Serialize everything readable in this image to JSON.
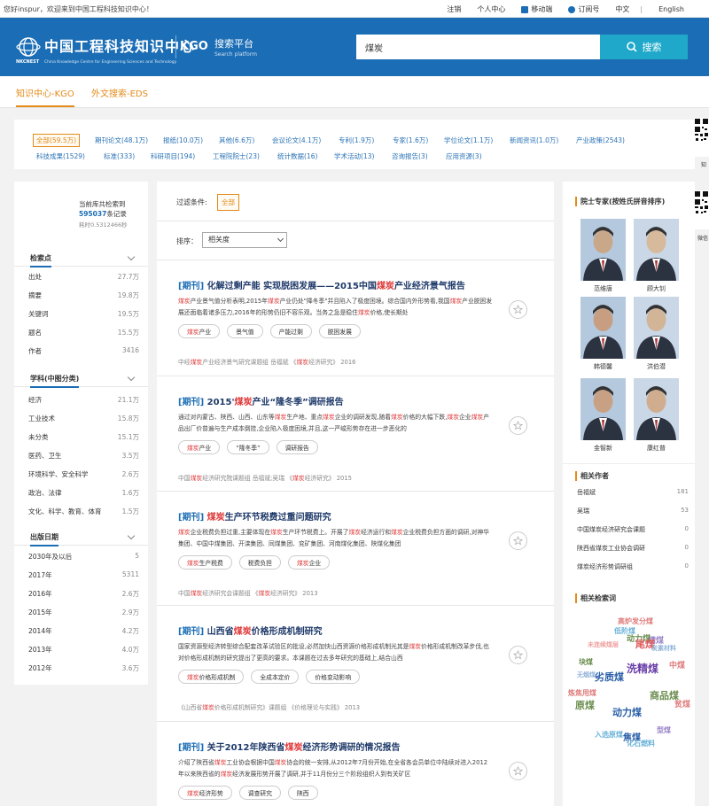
{
  "topbar": {
    "welcome": "您好inspur，欢迎来到中国工程科技知识中心！",
    "links": [
      "注销",
      "个人中心",
      "移动端",
      "订阅号",
      "中文",
      "|",
      "English"
    ]
  },
  "header": {
    "logo_abbr": "NKCNEST",
    "logo_title": "中国工程科技知识中心",
    "logo_subtitle": "China Knowledge Centre for Engineering Sciences and Technology",
    "kgo_mark": "KGO",
    "kgo_title": "搜索平台",
    "kgo_subtitle": "Search platform",
    "search_value": "煤炭",
    "search_button": "搜索"
  },
  "tabs": [
    {
      "label": "知识中心-KGO",
      "active": true
    },
    {
      "label": "外文搜索-EDS",
      "active": false
    }
  ],
  "categories": {
    "row1": [
      "全部(59.5万)",
      "期刊论文(48.1万)",
      "报纸(10.0万)",
      "其他(6.6万)",
      "会议论文(4.1万)",
      "专利(1.9万)",
      "专家(1.6万)",
      "学位论文(1.1万)",
      "新闻资讯(1.0万)",
      "产业政策(2543)"
    ],
    "row2": [
      "科技成果(1529)",
      "标准(333)",
      "科研项目(194)",
      "工程院院士(23)",
      "统计数据(16)",
      "学术活动(13)",
      "咨询报告(3)",
      "应用资源(3)"
    ]
  },
  "qr_labels": [
    "知",
    "微信"
  ],
  "stats": {
    "line1": "当前库共检索到",
    "count": "595037",
    "count_suffix": "条记录",
    "time": "耗时0.5312466秒"
  },
  "filters": {
    "retrieval": {
      "title": "检索点",
      "rows": [
        {
          "k": "出处",
          "v": "27.7万"
        },
        {
          "k": "摘要",
          "v": "19.8万"
        },
        {
          "k": "关键词",
          "v": "19.5万"
        },
        {
          "k": "题名",
          "v": "15.5万"
        },
        {
          "k": "作者",
          "v": "3416"
        }
      ]
    },
    "subject": {
      "title": "学科(中图分类)",
      "rows": [
        {
          "k": "经济",
          "v": "21.1万"
        },
        {
          "k": "工业技术",
          "v": "15.8万"
        },
        {
          "k": "未分类",
          "v": "15.1万"
        },
        {
          "k": "医药、卫生",
          "v": "3.5万"
        },
        {
          "k": "环境科学、安全科学",
          "v": "2.6万"
        },
        {
          "k": "政治、法律",
          "v": "1.6万"
        },
        {
          "k": "文化、科学、教育、体育",
          "v": "1.5万"
        }
      ]
    },
    "date": {
      "title": "出版日期",
      "rows": [
        {
          "k": "2030年及以后",
          "v": "5"
        },
        {
          "k": "2017年",
          "v": "5311"
        },
        {
          "k": "2016年",
          "v": "2.6万"
        },
        {
          "k": "2015年",
          "v": "2.9万"
        },
        {
          "k": "2014年",
          "v": "4.2万"
        },
        {
          "k": "2013年",
          "v": "4.0万"
        },
        {
          "k": "2012年",
          "v": "3.6万"
        }
      ]
    }
  },
  "results_head": {
    "filter_label": "过滤条件:",
    "filter_value": "全部",
    "sort_label": "排序：",
    "sort_value": "相关度"
  },
  "results": [
    {
      "tag": "[期刊]",
      "title_pre": "化解过剩产能 实现脱困发展——2015中国",
      "title_hl": "煤炭",
      "title_post": "产业经济景气报告",
      "abs_html": "<span class='hl'>煤炭</span>产业景气值分析表明,2015年<span class='hl'>煤炭</span>产业仍处\"降冬季\"并且陷入了极度困境。综合国内外形势看,我国<span class='hl'>煤炭</span>产业脱困发展还面临着诸多压力,2016年的形势仍旧不容乐观。当务之急是稳住<span class='hl'>煤炭</span>价格,使长期处",
      "keywords": [
        "煤炭产业",
        "景气值",
        "产能过剩",
        "脱困发展"
      ],
      "kw_hl": [
        true,
        false,
        false,
        false
      ],
      "src_html": "中经<span class='hl'>煤炭</span>产业经济景气研究课题组  岳福斌  《<span class='hl'>煤炭</span>经济研究》  2016"
    },
    {
      "tag": "[期刊]",
      "title_pre": "2015'",
      "title_hl": "煤炭",
      "title_post": "产业“隆冬季”调研报告",
      "abs_html": "通过对内蒙古、陕西、山西、山东等<span class='hl'>煤炭</span>生产地、重点<span class='hl'>煤炭</span>企业的调研发现,随着<span class='hl'>煤炭</span>价格的大幅下跌,<span class='hl'>煤炭</span>企业<span class='hl'>煤炭</span>产品出厂价普遍与生产成本倒挂,企业陷入极度困境,并且,这一严峻形势存在进一步恶化的",
      "keywords": [
        "煤炭产业",
        "“隆冬季”",
        "调研报告"
      ],
      "kw_hl": [
        true,
        false,
        false
      ],
      "src_html": "中国<span class='hl'>煤炭</span>经济研究院课题组  岳福斌;吴瑞  《<span class='hl'>煤炭</span>经济研究》  2015"
    },
    {
      "tag": "[期刊]",
      "title_pre": "",
      "title_hl": "煤炭",
      "title_post": "生产环节税费过重问题研究",
      "abs_html": "<span class='hl'>煤炭</span>企业税费负担过重,主要体现在<span class='hl'>煤炭</span>生产环节税费上。开展了<span class='hl'>煤炭</span>经济运行和<span class='hl'>煤炭</span>企业税费负担方面的调研,对神华集团、中国中煤集团、开滦集团、同煤集团、兖矿集团、河南煤化集团、陕煤化集团",
      "keywords": [
        "煤炭生产税费",
        "税费负担",
        "煤炭企业"
      ],
      "kw_hl": [
        true,
        false,
        true
      ],
      "src_html": "中国<span class='hl'>煤炭</span>经济研究会课题组  《<span class='hl'>煤炭</span>经济研究》  2013"
    },
    {
      "tag": "[期刊]",
      "title_pre": "山西省",
      "title_hl": "煤炭",
      "title_post": "价格形成机制研究",
      "abs_html": "国家资源型经济转型综合配套改革试验区的批设,必然加快山西资源价格形成机制光其是<span class='hl'>煤炭</span>价格形成机制改革步伐,也对价格形成机制的研究提出了更高的要求。本课题在过去多年研究的基础上,结合山西",
      "keywords": [
        "煤炭价格形成机制",
        "全成本定价",
        "价格变动影响"
      ],
      "kw_hl": [
        true,
        false,
        false
      ],
      "src_html": "《山西省<span class='hl'>煤炭</span>价格形成机制研究》课题组  《价格理论与实践》  2013"
    },
    {
      "tag": "[期刊]",
      "title_pre": "关于2012年陕西省",
      "title_hl": "煤炭",
      "title_post": "经济形势调研的情况报告",
      "abs_html": "介绍了陕西省<span class='hl'>煤炭</span>工业协会根据中国<span class='hl'>煤炭</span>协会的统一安排,从2012年7月份开始,在全省各会员单位中陆续对进入2012年以来陕西省的<span class='hl'>煤炭</span>经济发展形势开展了调研,并于11月份分三个阶段组织人到有关矿区",
      "keywords": [
        "煤炭经济形势",
        "调查研究",
        "陕西"
      ],
      "kw_hl": [
        true,
        false,
        false
      ],
      "src_html": ""
    }
  ],
  "experts": {
    "title": "院士专家(按姓氏拼音排序)",
    "people": [
      "范维唐",
      "顾大钊",
      "韩德馨",
      "洪伯潜",
      "金智新",
      "康红普"
    ]
  },
  "authors": {
    "title": "相关作者",
    "rows": [
      {
        "k": "岳福斌",
        "v": "181"
      },
      {
        "k": "吴瑞",
        "v": "53"
      },
      {
        "k": "中国煤炭经济研究会课题",
        "v": "0"
      },
      {
        "k": "陕西省煤炭工业协会调研",
        "v": "0"
      },
      {
        "k": "煤炭经济形势调研组",
        "v": "0"
      }
    ]
  },
  "keywords_cloud": {
    "title": "相关检索词",
    "words": [
      {
        "t": "低阶煤",
        "c": "#6bb3d9"
      },
      {
        "t": "高炉发分煤",
        "c": "#e07c7c"
      },
      {
        "t": "精煤",
        "c": "#9a86c9"
      },
      {
        "t": "动力煤",
        "c": "#6b8e4e"
      },
      {
        "t": "未连续煤层",
        "c": "#f0a0a0"
      },
      {
        "t": "尾煤",
        "c": "#e05a5a"
      },
      {
        "t": "炭素材料",
        "c": "#8fb3d9"
      },
      {
        "t": "块煤",
        "c": "#6b8e4e"
      },
      {
        "t": "劣质煤",
        "c": "#2a5fa8"
      },
      {
        "t": "洗精煤",
        "c": "#6a3fa8"
      },
      {
        "t": "中煤",
        "c": "#e07c7c"
      },
      {
        "t": "无烟煤",
        "c": "#8fb3d9"
      },
      {
        "t": "商品煤",
        "c": "#6b8e4e"
      },
      {
        "t": "炼焦用煤",
        "c": "#e07c7c"
      },
      {
        "t": "原煤",
        "c": "#6b8e4e"
      },
      {
        "t": "动力煤",
        "c": "#2a5fa8"
      },
      {
        "t": "焦煤",
        "c": "#2a5fa8"
      },
      {
        "t": "入选原煤",
        "c": "#6bb3d9"
      },
      {
        "t": "化石燃料",
        "c": "#6bb3d9"
      },
      {
        "t": "型煤",
        "c": "#9a86c9"
      },
      {
        "t": "贫煤",
        "c": "#e07c7c"
      }
    ]
  },
  "colors": {
    "brand": "#1b6db5",
    "accent": "#e48b1a",
    "highlight": "#e03b3b",
    "search_button": "#1fa8c9"
  }
}
